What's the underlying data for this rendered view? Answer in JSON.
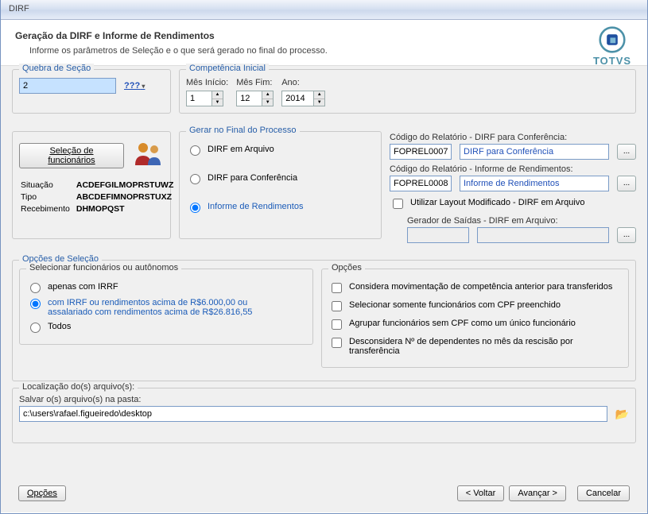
{
  "window": {
    "title": "DIRF"
  },
  "header": {
    "title": "Geração da DIRF e Informe de Rendimentos",
    "subtitle": "Informe os parâmetros de Seleção e o que será gerado no final do processo.",
    "logo_text": "TOTVS"
  },
  "quebra": {
    "legend": "Quebra de Seção",
    "value": "2",
    "help_label": "???"
  },
  "competencia": {
    "legend": "Competência Inicial",
    "mes_inicio_label": "Mês Início:",
    "mes_inicio_value": "1",
    "mes_fim_label": "Mês Fim:",
    "mes_fim_value": "12",
    "ano_label": "Ano:",
    "ano_value": "2014"
  },
  "selecao_funcionarios": {
    "button_label": "Seleção de funcionários",
    "meta": {
      "situacao_label": "Situação",
      "situacao_value": "ACDEFGILMOPRSTUWZ",
      "tipo_label": "Tipo",
      "tipo_value": "ABCDEFIMNOPRSTUXZ",
      "receb_label": "Recebimento",
      "receb_value": "DHMOPQST"
    }
  },
  "gerar_processo": {
    "legend": "Gerar no Final do Processo",
    "opt1": "DIRF em Arquivo",
    "opt2": "DIRF para Conferência",
    "opt3": "Informe de Rendimentos"
  },
  "relatorios": {
    "conf_label": "Código do Relatório - DIRF para Conferência:",
    "conf_code": "FOPREL0007",
    "conf_desc": "DIRF para Conferência",
    "inf_label": "Código do Relatório - Informe de Rendimentos:",
    "inf_code": "FOPREL0008",
    "inf_desc": "Informe de Rendimentos",
    "layout_mod_label": "Utilizar Layout Modificado - DIRF em Arquivo",
    "gerador_label": "Gerador de Saídas - DIRF em Arquivo:"
  },
  "opcoes_selecao": {
    "legend": "Opções de Seleção",
    "sub_legend_esq": "Selecionar funcionários ou autônomos",
    "r1": "apenas com IRRF",
    "r2": "com IRRF ou rendimentos acima de R$6.000,00 ou assalariado com rendimentos acima de R$26.816,55",
    "r3": "Todos",
    "sub_legend_dir": "Opções",
    "c1": "Considera movimentação de competência anterior para transferidos",
    "c2": "Selecionar somente funcionários com CPF preenchido",
    "c3": "Agrupar funcionários sem CPF como um único funcionário",
    "c4": "Desconsidera Nº de dependentes no mês da rescisão por transferência"
  },
  "localizacao": {
    "legend": "Localização do(s) arquivo(s):",
    "salvar_label": "Salvar o(s) arquivo(s) na pasta:",
    "path": "c:\\users\\rafael.figueiredo\\desktop"
  },
  "footer": {
    "opcoes": "Opções",
    "voltar": "< Voltar",
    "avancar": "Avançar >",
    "cancelar": "Cancelar"
  }
}
